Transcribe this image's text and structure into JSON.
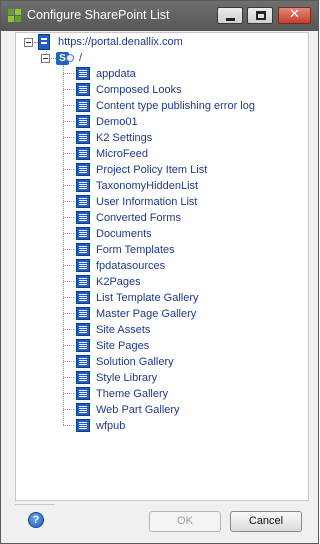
{
  "window": {
    "title": "Configure SharePoint List",
    "controls": {
      "minimize_icon": "minimize-icon",
      "maximize_icon": "maximize-icon",
      "close_icon": "close-icon",
      "close_glyph": "✕"
    }
  },
  "tree": {
    "server": {
      "label": "https://portal.denallix.com",
      "icon": "server-icon"
    },
    "site": {
      "label": "/",
      "icon": "sharepoint-site-icon",
      "icon_glyph": "S"
    },
    "lists": [
      "appdata",
      "Composed Looks",
      "Content type publishing error log",
      "Demo01",
      "K2 Settings",
      "MicroFeed",
      "Project Policy Item List",
      "TaxonomyHiddenList",
      "User Information List",
      "Converted Forms",
      "Documents",
      "Form Templates",
      "fpdatasources",
      "K2Pages",
      "List Template Gallery",
      "Master Page Gallery",
      "Site Assets",
      "Site Pages",
      "Solution Gallery",
      "Style Library",
      "Theme Gallery",
      "Web Part Gallery",
      "wfpub"
    ]
  },
  "footer": {
    "help_glyph": "?",
    "ok_label": "OK",
    "cancel_label": "Cancel"
  },
  "colors": {
    "titlebar": "#606060",
    "tree_text": "#1e3a8a",
    "list_icon": "#1f5fbf",
    "close_button": "#c6402a"
  }
}
